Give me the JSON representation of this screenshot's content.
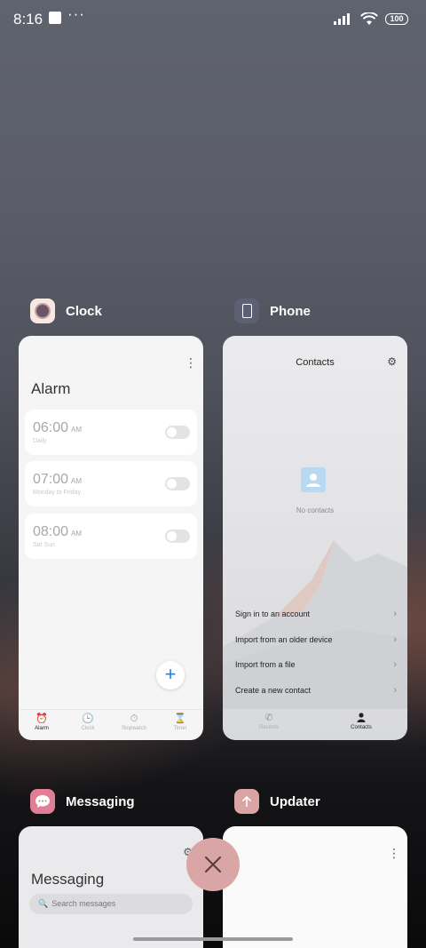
{
  "status_bar": {
    "time": "8:16",
    "dots": "···",
    "battery": "100"
  },
  "apps": {
    "clock": {
      "name": "Clock",
      "title": "Alarm",
      "alarms": [
        {
          "time": "06:00",
          "ampm": "AM",
          "repeat": "Daily"
        },
        {
          "time": "07:00",
          "ampm": "AM",
          "repeat": "Monday to Friday"
        },
        {
          "time": "08:00",
          "ampm": "AM",
          "repeat": "Sat Sun"
        }
      ],
      "add_label": "+",
      "tabs": [
        "Alarm",
        "Clock",
        "Stopwatch",
        "Timer"
      ]
    },
    "phone": {
      "name": "Phone",
      "title": "Contacts",
      "empty_text": "No contacts",
      "options": [
        "Sign in to an account",
        "Import from an older device",
        "Import from a file",
        "Create a new contact"
      ],
      "tabs": [
        "Recents",
        "Contacts"
      ]
    },
    "messaging": {
      "name": "Messaging",
      "title": "Messaging",
      "search_placeholder": "Search messages"
    },
    "updater": {
      "name": "Updater"
    }
  },
  "colors": {
    "close_button": "#d9a5a5",
    "fab_accent": "#2a7de1"
  }
}
